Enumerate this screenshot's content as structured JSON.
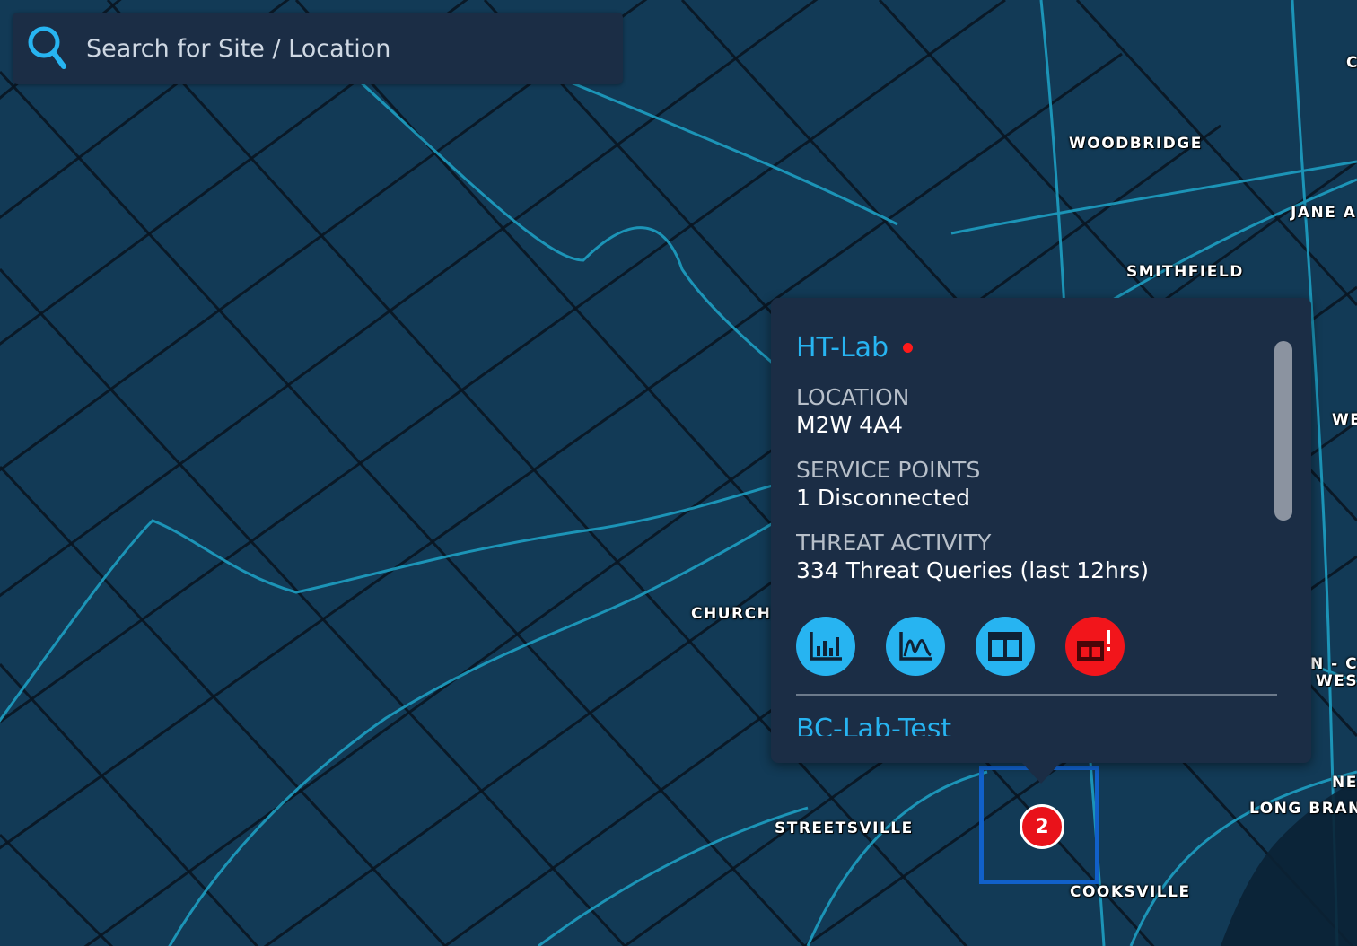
{
  "search": {
    "placeholder": "Search for Site / Location"
  },
  "map": {
    "labels": {
      "woodbridge": "WOODBRIDGE",
      "jane": "JANE A",
      "smithfield": "SMITHFIELD",
      "we": "WE",
      "church": "CHURCH",
      "n_c": "N - C",
      "wes": "WES",
      "ne": "NE",
      "long_branch": "LONG BRAN",
      "streetsville": "STREETSVILLE",
      "cooksville": "COOKSVILLE",
      "c_edge": "C"
    },
    "cluster_count": "2"
  },
  "popup": {
    "site_name": "HT-Lab",
    "location_label": "LOCATION",
    "location_value": "M2W 4A4",
    "service_points_label": "SERVICE POINTS",
    "service_points_value": "1 Disconnected",
    "threat_activity_label": "THREAT ACTIVITY",
    "threat_activity_value": "334 Threat Queries (last 12hrs)",
    "actions": [
      {
        "icon": "bar-chart-icon"
      },
      {
        "icon": "line-chart-icon"
      },
      {
        "icon": "dashboard-icon"
      },
      {
        "icon": "device-alert-icon"
      }
    ],
    "next_site_name": "BC-Lab-Test"
  },
  "colors": {
    "map_bg": "#123a56",
    "panel_bg": "#1b2d45",
    "accent": "#27b4f1",
    "alert": "#f2151b",
    "selection": "#1160c9"
  }
}
